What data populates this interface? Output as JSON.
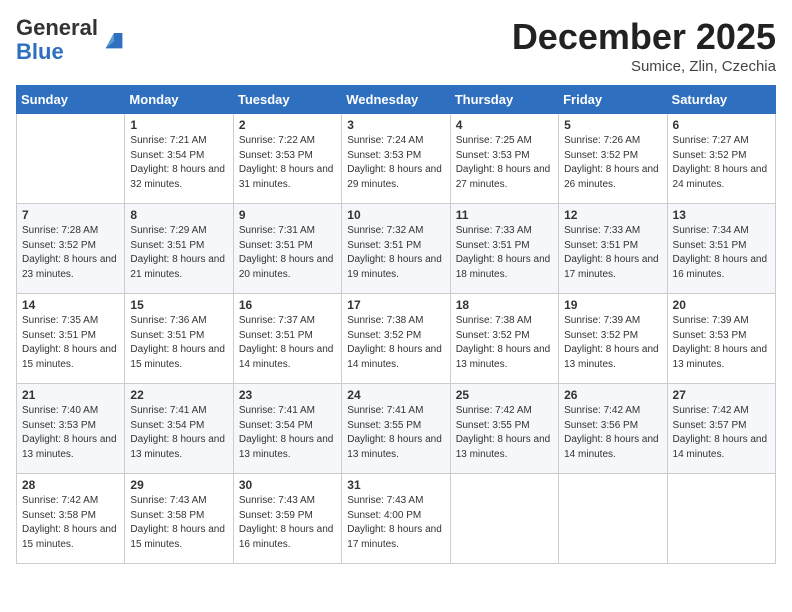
{
  "header": {
    "logo_general": "General",
    "logo_blue": "Blue",
    "month_title": "December 2025",
    "location": "Sumice, Zlin, Czechia"
  },
  "days_of_week": [
    "Sunday",
    "Monday",
    "Tuesday",
    "Wednesday",
    "Thursday",
    "Friday",
    "Saturday"
  ],
  "weeks": [
    [
      {
        "day": "",
        "sunrise": "",
        "sunset": "",
        "daylight": ""
      },
      {
        "day": "1",
        "sunrise": "7:21 AM",
        "sunset": "3:54 PM",
        "daylight": "8 hours and 32 minutes."
      },
      {
        "day": "2",
        "sunrise": "7:22 AM",
        "sunset": "3:53 PM",
        "daylight": "8 hours and 31 minutes."
      },
      {
        "day": "3",
        "sunrise": "7:24 AM",
        "sunset": "3:53 PM",
        "daylight": "8 hours and 29 minutes."
      },
      {
        "day": "4",
        "sunrise": "7:25 AM",
        "sunset": "3:53 PM",
        "daylight": "8 hours and 27 minutes."
      },
      {
        "day": "5",
        "sunrise": "7:26 AM",
        "sunset": "3:52 PM",
        "daylight": "8 hours and 26 minutes."
      },
      {
        "day": "6",
        "sunrise": "7:27 AM",
        "sunset": "3:52 PM",
        "daylight": "8 hours and 24 minutes."
      }
    ],
    [
      {
        "day": "7",
        "sunrise": "7:28 AM",
        "sunset": "3:52 PM",
        "daylight": "8 hours and 23 minutes."
      },
      {
        "day": "8",
        "sunrise": "7:29 AM",
        "sunset": "3:51 PM",
        "daylight": "8 hours and 21 minutes."
      },
      {
        "day": "9",
        "sunrise": "7:31 AM",
        "sunset": "3:51 PM",
        "daylight": "8 hours and 20 minutes."
      },
      {
        "day": "10",
        "sunrise": "7:32 AM",
        "sunset": "3:51 PM",
        "daylight": "8 hours and 19 minutes."
      },
      {
        "day": "11",
        "sunrise": "7:33 AM",
        "sunset": "3:51 PM",
        "daylight": "8 hours and 18 minutes."
      },
      {
        "day": "12",
        "sunrise": "7:33 AM",
        "sunset": "3:51 PM",
        "daylight": "8 hours and 17 minutes."
      },
      {
        "day": "13",
        "sunrise": "7:34 AM",
        "sunset": "3:51 PM",
        "daylight": "8 hours and 16 minutes."
      }
    ],
    [
      {
        "day": "14",
        "sunrise": "7:35 AM",
        "sunset": "3:51 PM",
        "daylight": "8 hours and 15 minutes."
      },
      {
        "day": "15",
        "sunrise": "7:36 AM",
        "sunset": "3:51 PM",
        "daylight": "8 hours and 15 minutes."
      },
      {
        "day": "16",
        "sunrise": "7:37 AM",
        "sunset": "3:51 PM",
        "daylight": "8 hours and 14 minutes."
      },
      {
        "day": "17",
        "sunrise": "7:38 AM",
        "sunset": "3:52 PM",
        "daylight": "8 hours and 14 minutes."
      },
      {
        "day": "18",
        "sunrise": "7:38 AM",
        "sunset": "3:52 PM",
        "daylight": "8 hours and 13 minutes."
      },
      {
        "day": "19",
        "sunrise": "7:39 AM",
        "sunset": "3:52 PM",
        "daylight": "8 hours and 13 minutes."
      },
      {
        "day": "20",
        "sunrise": "7:39 AM",
        "sunset": "3:53 PM",
        "daylight": "8 hours and 13 minutes."
      }
    ],
    [
      {
        "day": "21",
        "sunrise": "7:40 AM",
        "sunset": "3:53 PM",
        "daylight": "8 hours and 13 minutes."
      },
      {
        "day": "22",
        "sunrise": "7:41 AM",
        "sunset": "3:54 PM",
        "daylight": "8 hours and 13 minutes."
      },
      {
        "day": "23",
        "sunrise": "7:41 AM",
        "sunset": "3:54 PM",
        "daylight": "8 hours and 13 minutes."
      },
      {
        "day": "24",
        "sunrise": "7:41 AM",
        "sunset": "3:55 PM",
        "daylight": "8 hours and 13 minutes."
      },
      {
        "day": "25",
        "sunrise": "7:42 AM",
        "sunset": "3:55 PM",
        "daylight": "8 hours and 13 minutes."
      },
      {
        "day": "26",
        "sunrise": "7:42 AM",
        "sunset": "3:56 PM",
        "daylight": "8 hours and 14 minutes."
      },
      {
        "day": "27",
        "sunrise": "7:42 AM",
        "sunset": "3:57 PM",
        "daylight": "8 hours and 14 minutes."
      }
    ],
    [
      {
        "day": "28",
        "sunrise": "7:42 AM",
        "sunset": "3:58 PM",
        "daylight": "8 hours and 15 minutes."
      },
      {
        "day": "29",
        "sunrise": "7:43 AM",
        "sunset": "3:58 PM",
        "daylight": "8 hours and 15 minutes."
      },
      {
        "day": "30",
        "sunrise": "7:43 AM",
        "sunset": "3:59 PM",
        "daylight": "8 hours and 16 minutes."
      },
      {
        "day": "31",
        "sunrise": "7:43 AM",
        "sunset": "4:00 PM",
        "daylight": "8 hours and 17 minutes."
      },
      {
        "day": "",
        "sunrise": "",
        "sunset": "",
        "daylight": ""
      },
      {
        "day": "",
        "sunrise": "",
        "sunset": "",
        "daylight": ""
      },
      {
        "day": "",
        "sunrise": "",
        "sunset": "",
        "daylight": ""
      }
    ]
  ],
  "labels": {
    "sunrise": "Sunrise:",
    "sunset": "Sunset:",
    "daylight": "Daylight:"
  }
}
